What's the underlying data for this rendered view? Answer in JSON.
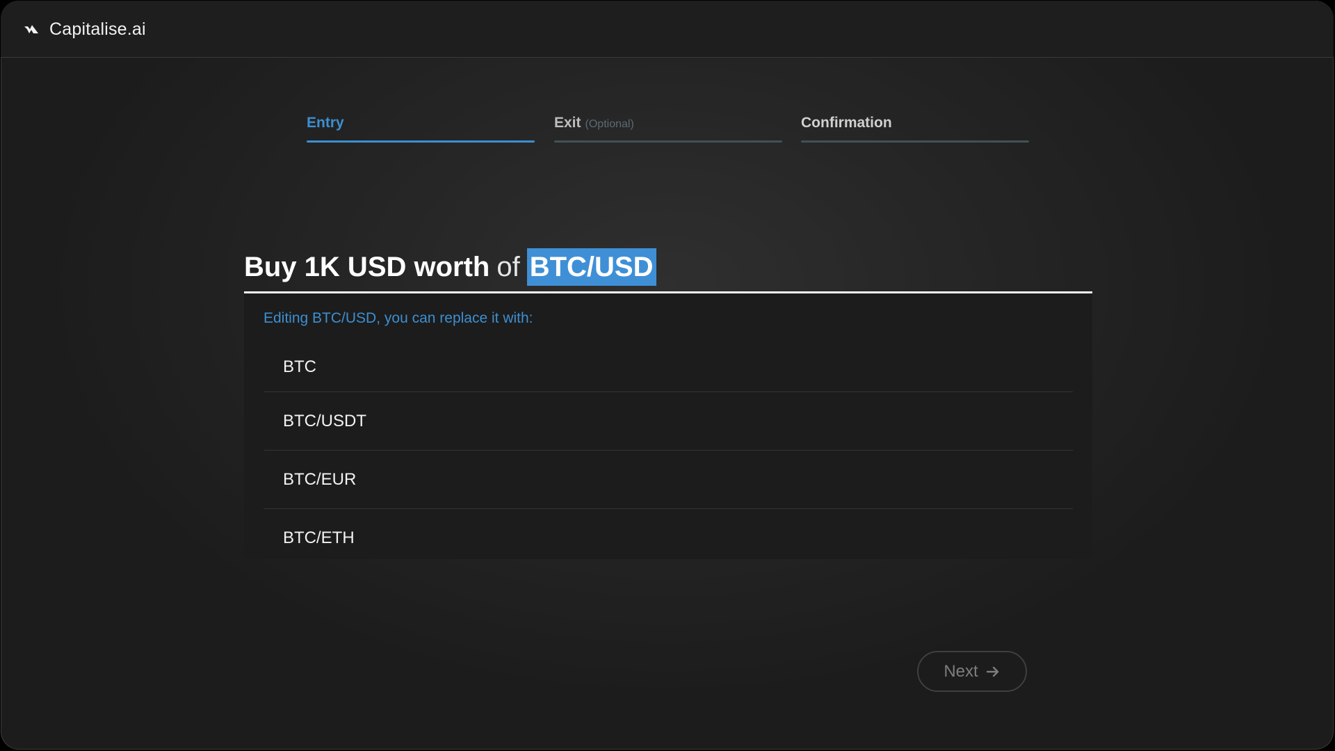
{
  "app": {
    "name": "Capitalise.ai"
  },
  "steps": [
    {
      "label": "Entry",
      "optional": ""
    },
    {
      "label": "Exit",
      "optional": "(Optional)"
    },
    {
      "label": "Confirmation",
      "optional": ""
    }
  ],
  "sentence": {
    "part1": "Buy 1K USD worth",
    "part2": "of",
    "token": "BTC/USD"
  },
  "dropdown": {
    "hint": "Editing BTC/USD, you can replace it with:",
    "options": [
      "BTC",
      "BTC/USDT",
      "BTC/EUR",
      "BTC/ETH"
    ]
  },
  "actions": {
    "next_label": "Next"
  },
  "colors": {
    "accent": "#3d8fd1",
    "highlight": "#3f8fd6",
    "inactive_step_bar": "#425256"
  },
  "icons": {
    "brand": "capitalise-logo-icon",
    "next": "arrow-right-icon"
  }
}
